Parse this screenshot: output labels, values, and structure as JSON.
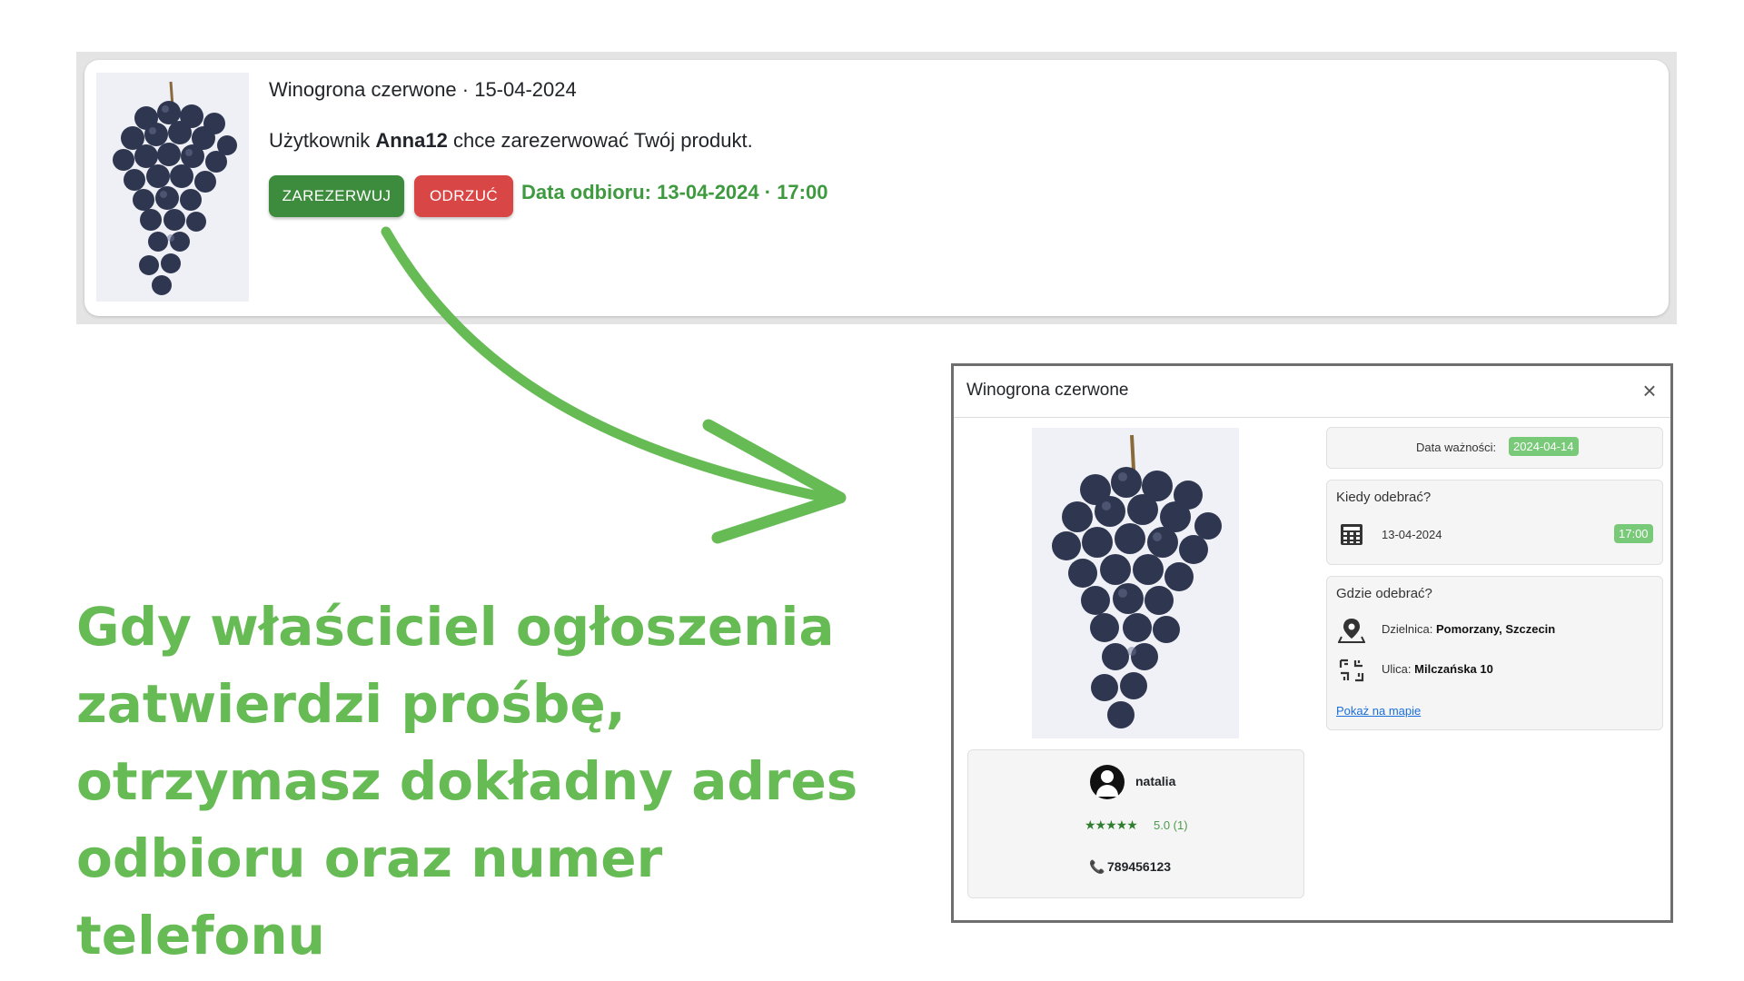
{
  "notification": {
    "title": "Winogrona czerwone · 15-04-2024",
    "message_prefix": "Użytkownik ",
    "username": "Anna12",
    "message_suffix": " chce zarezerwować Twój produkt.",
    "accept_label": "ZAREZERWUJ",
    "reject_label": "ODRZUĆ",
    "pickup": "Data odbioru: 13-04-2024 · 17:00"
  },
  "caption": {
    "text": "Gdy właściciel ogłoszenia zatwierdzi prośbę, otrzymasz dokładny adres odbioru oraz numer telefonu"
  },
  "modal": {
    "title": "Winogrona czerwone",
    "close": "×",
    "seller": {
      "name": "natalia",
      "stars": "★★★★★",
      "rating": "5.0 (1)",
      "phone_icon": "📞",
      "phone": "789456123"
    },
    "expiry": {
      "label": "Data ważności:",
      "value": "2024-04-14"
    },
    "when": {
      "heading": "Kiedy odebrać?",
      "date": "13-04-2024",
      "time": "17:00"
    },
    "where": {
      "heading": "Gdzie odebrać?",
      "district_label": "Dzielnica:",
      "district": "Pomorzany, Szczecin",
      "street_label": "Ulica:",
      "street": "Milczańska 10",
      "map_link": "Pokaż na mapie"
    }
  },
  "colors": {
    "accept": "#3d8b3d",
    "reject": "#d94646",
    "pickup_text": "#3e9a3e",
    "caption": "#66bb55",
    "arrow": "#66bb55",
    "pill": "#78c978",
    "link": "#1a6fd9"
  },
  "icons": [
    "grapes-image",
    "arrow-graphic",
    "close-icon",
    "user-avatar-icon",
    "star-icon",
    "phone-icon",
    "calendar-icon",
    "map-pin-icon",
    "street-icon"
  ]
}
